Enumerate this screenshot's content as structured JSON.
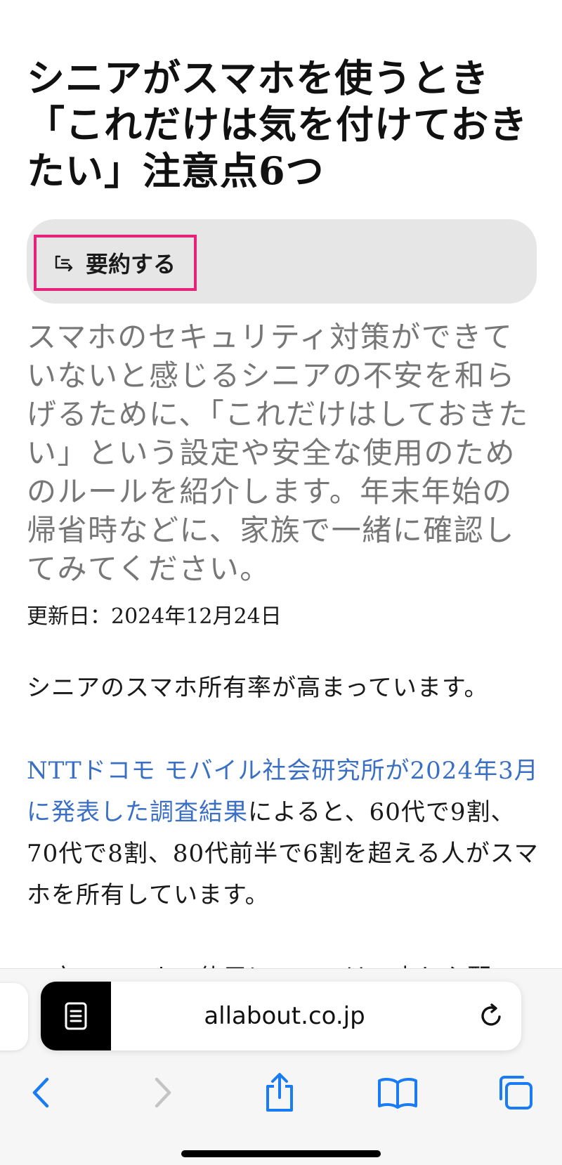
{
  "article": {
    "title": "シニアがスマホを使うとき「これだけは気を付けておきたい」注意点6つ",
    "summary_button": {
      "label": "要約する",
      "icon": "summary-list-icon"
    },
    "lead": "スマホのセキュリティ対策ができていないと感じるシニアの不安を和らげるために、「これだけはしておきたい」という設定や安全な使用のためのルールを紹介します。年末年始の帰省時などに、家族で一緒に確認してみてください。",
    "updated": "更新日：2024年12月24日",
    "paragraphs": {
      "p1_text": "シニアのスマホ所有率が高まっています。",
      "p2_link": "NTTドコモ モバイル社会研究所が2024年3月に発表した調査結果",
      "p2_text": "によると、60代で9割、70代で8割、80代前半で6割を超える人がスマホを所有しています。",
      "p3_text": "一方でスマホの使用については、少し心配"
    }
  },
  "browser": {
    "url": "allabout.co.jp",
    "icons": {
      "reader": "reader-mode-icon",
      "reload": "reload-icon",
      "back": "back-chevron-icon",
      "forward": "forward-chevron-icon",
      "share": "share-icon",
      "bookmarks": "bookmarks-book-icon",
      "tabs": "tabs-icon"
    },
    "colors": {
      "accent": "#1a7cf5",
      "disabled": "#c4c4c4",
      "highlight": "#e8217a",
      "link": "#3a6fc4"
    }
  }
}
